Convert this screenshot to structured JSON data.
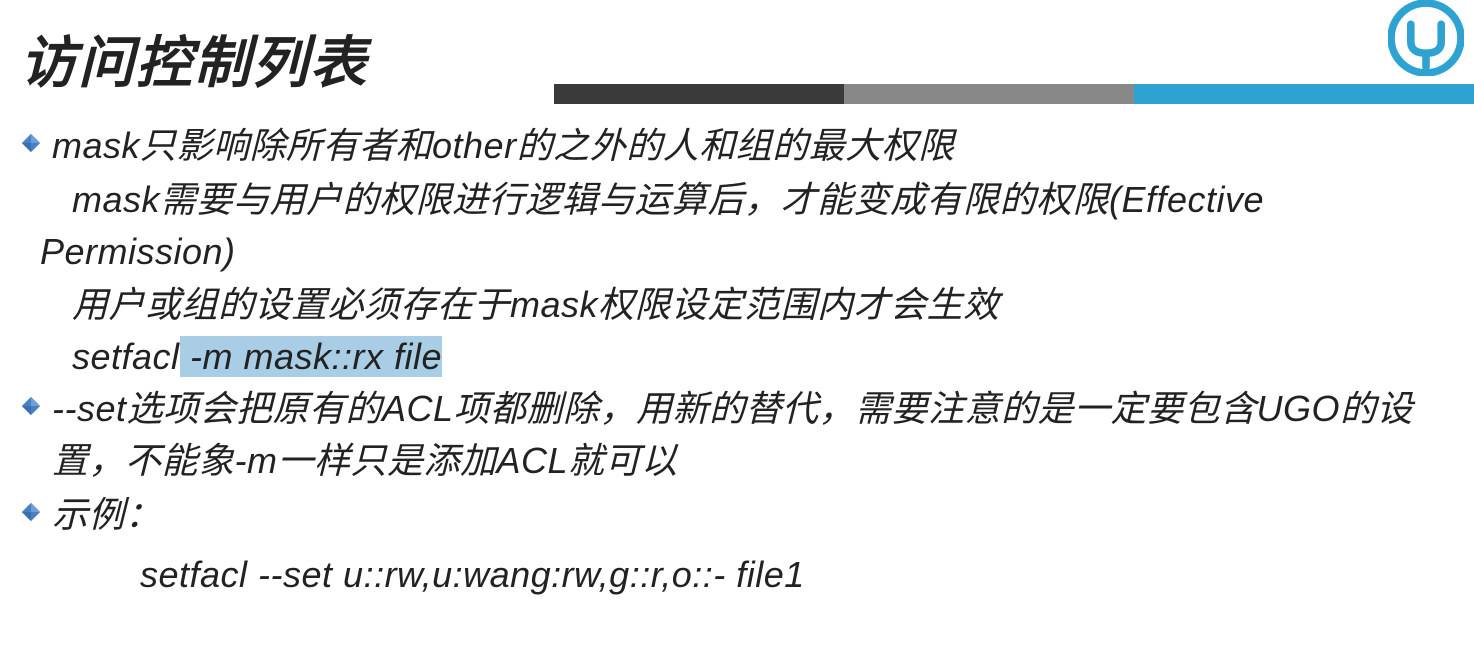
{
  "header": {
    "title": "访问控制列表"
  },
  "bullets": {
    "b1": {
      "line1": "mask只影响除所有者和other的之外的人和组的最大权限",
      "line2a": "mask需要与用户的权限进行逻辑与运算后，才能变成有限的权限(Effective",
      "line2b": "Permission)",
      "line3": "用户或组的设置必须存在于mask权限设定范围内才会生效",
      "line4_pre": "setfacl",
      "line4_hl": "  -m mask::rx  file"
    },
    "b2": {
      "line1": "--set选项会把原有的ACL项都删除，用新的替代，需要注意的是一定要包含UGO的设置，不能象-m一样只是添加ACL就可以"
    },
    "b3": {
      "label": "示例：",
      "code": "setfacl --set u::rw,u:wang:rw,g::r,o::- file1"
    }
  }
}
